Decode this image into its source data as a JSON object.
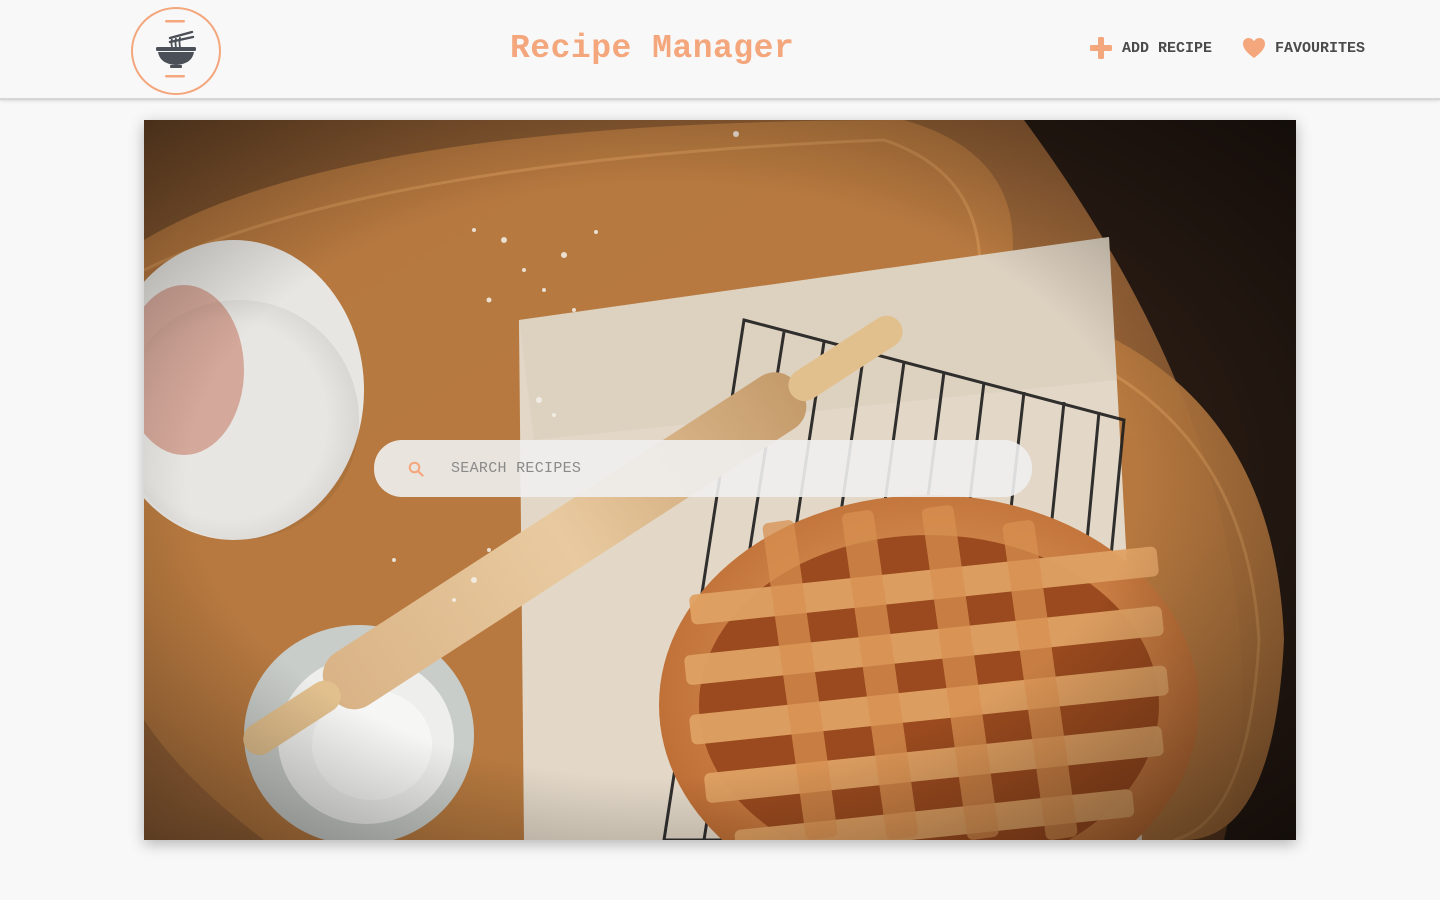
{
  "app": {
    "title": "Recipe Manager",
    "logo_icon": "noodle-bowl-icon"
  },
  "nav": {
    "add_recipe": {
      "label": "ADD RECIPE",
      "icon": "plus-icon"
    },
    "favourites": {
      "label": "FAVOURITES",
      "icon": "heart-icon"
    }
  },
  "search": {
    "placeholder": "SEARCH RECIPES",
    "value": "",
    "icon": "search-icon"
  },
  "colors": {
    "accent": "#f4a67c",
    "text": "#4a4a4a",
    "background": "#f8f8f8",
    "logo_dark": "#4b4f57"
  }
}
